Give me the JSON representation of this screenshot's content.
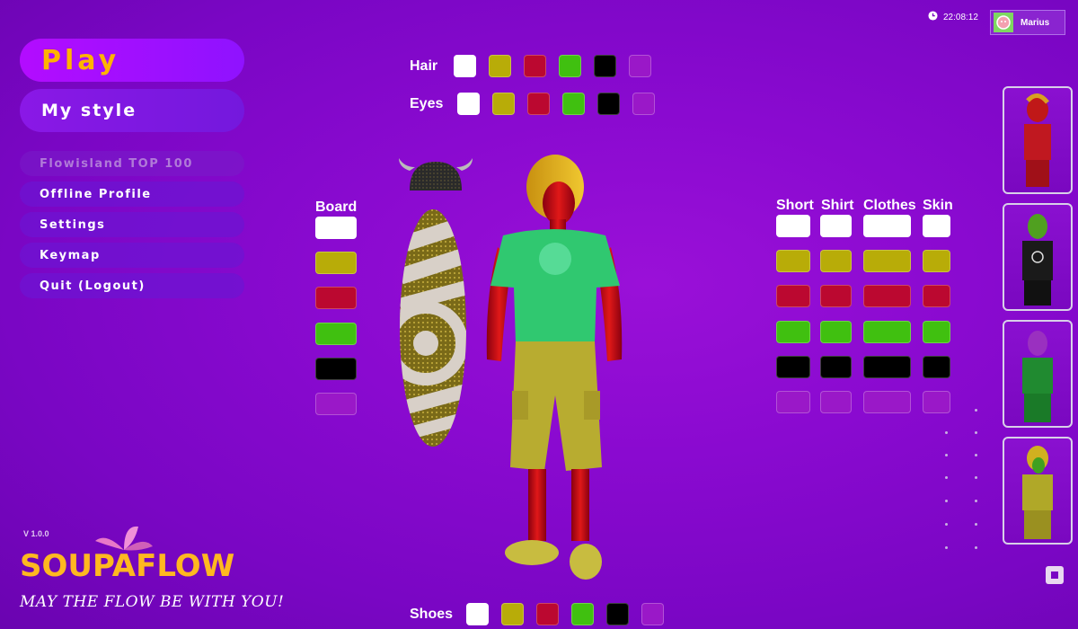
{
  "menu": {
    "play": "Play",
    "my_style": "My style",
    "items": [
      {
        "label": "Flowisland TOP 100",
        "disabled": true
      },
      {
        "label": "Offline Profile",
        "disabled": false
      },
      {
        "label": "Settings",
        "disabled": false
      },
      {
        "label": "Keymap",
        "disabled": false
      },
      {
        "label": "Quit (Logout)",
        "disabled": false
      }
    ]
  },
  "header": {
    "time": "22:08:12",
    "username": "Marius"
  },
  "colors": {
    "palette": [
      "#ffffff",
      "#b8ac08",
      "#bb0830",
      "#40c010",
      "#000000",
      "#9a18c8"
    ]
  },
  "rows": {
    "hair": "Hair",
    "eyes": "Eyes",
    "shoes": "Shoes",
    "board": "Board"
  },
  "columns": {
    "short": "Short",
    "shirt": "Shirt",
    "clothes": "Clothes",
    "skin": "Skin"
  },
  "footer": {
    "version": "V 1.0.0",
    "logo": "SOUPAFLOW",
    "tagline": "MAY THE FLOW BE WITH YOU!"
  },
  "icons": {
    "clock": "clock-icon",
    "avatar": "avatar-icon",
    "stop": "stop-icon"
  }
}
